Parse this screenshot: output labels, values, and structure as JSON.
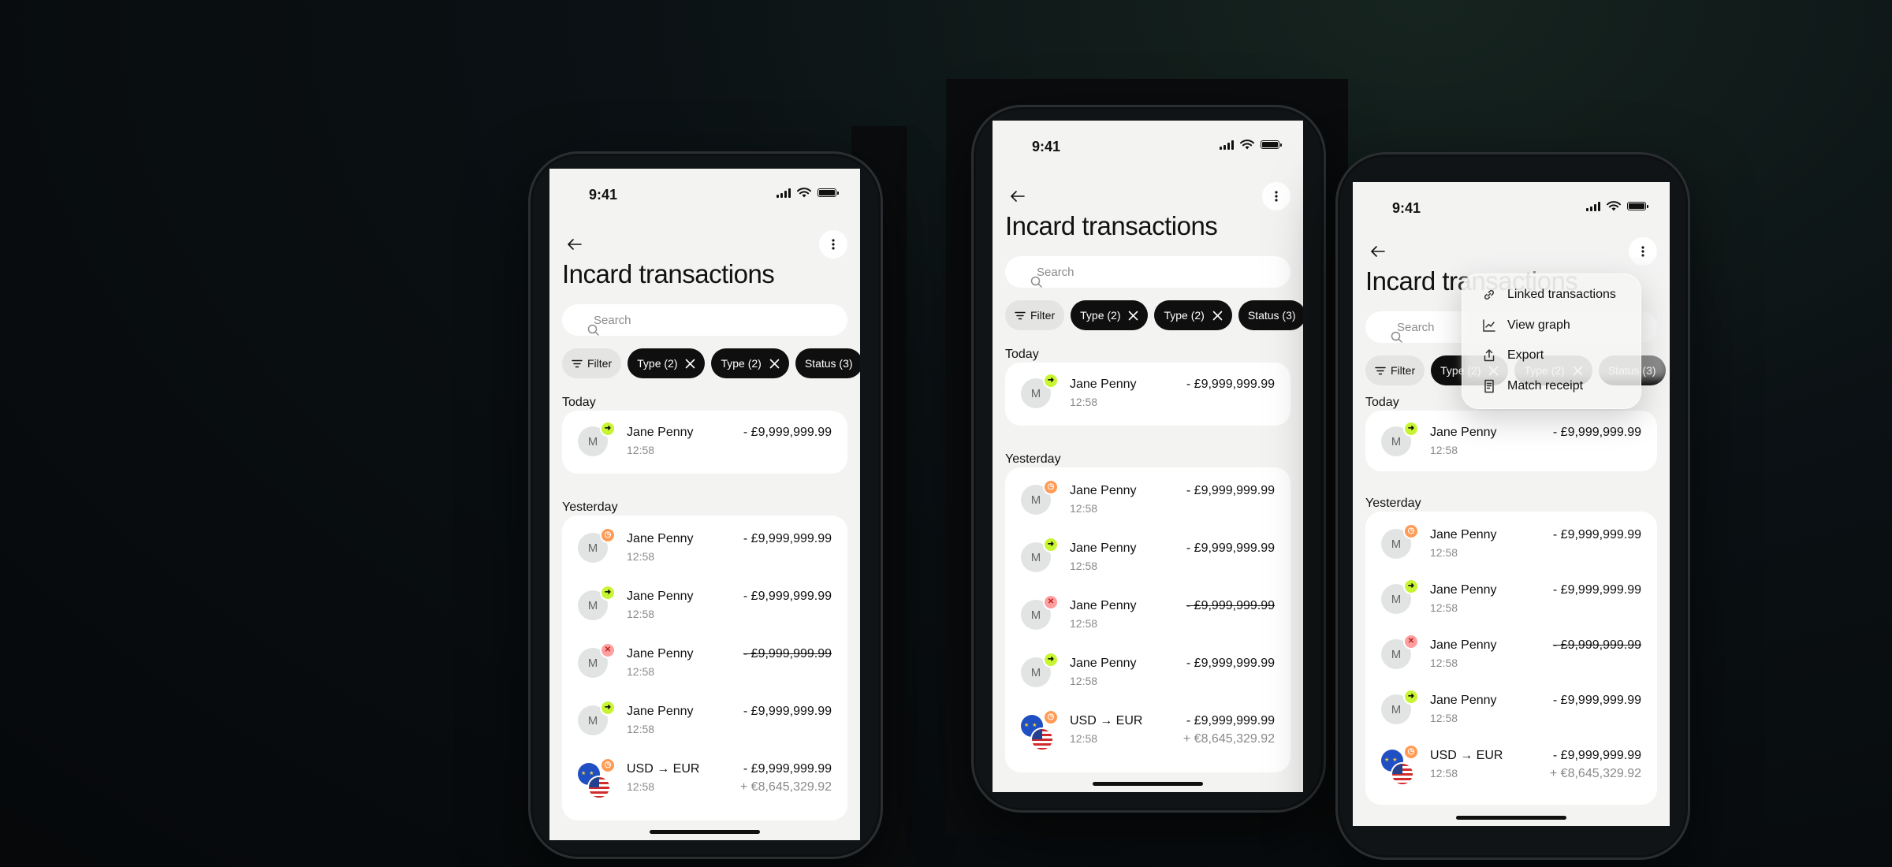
{
  "status_bar": {
    "time": "9:41"
  },
  "header": {
    "title": "Incard transactions"
  },
  "search": {
    "placeholder": "Search"
  },
  "chips": [
    {
      "label": "Filter"
    },
    {
      "label": "Type (2)"
    },
    {
      "label": "Type (2)"
    },
    {
      "label": "Status (3)"
    }
  ],
  "sections": {
    "today": "Today",
    "yesterday": "Yesterday"
  },
  "today_transactions": [
    {
      "avatar": "M",
      "badge": "arrow",
      "name": "Jane Penny",
      "time": "12:58",
      "amount": "- £9,999,999.99"
    }
  ],
  "yesterday_transactions": [
    {
      "avatar": "M",
      "badge": "clock",
      "name": "Jane Penny",
      "time": "12:58",
      "amount": "- £9,999,999.99"
    },
    {
      "avatar": "M",
      "badge": "arrow",
      "name": "Jane Penny",
      "time": "12:58",
      "amount": "- £9,999,999.99"
    },
    {
      "avatar": "M",
      "badge": "cross",
      "name": "Jane Penny",
      "time": "12:58",
      "amount": "- £9,999,999.99",
      "strike": true
    },
    {
      "avatar": "M",
      "badge": "arrow",
      "name": "Jane Penny",
      "time": "12:58",
      "amount": "- £9,999,999.99"
    },
    {
      "avatar": "flags",
      "badge": "clock",
      "name": "USD → EUR",
      "time": "12:58",
      "amount": "- £9,999,999.99",
      "sub_amount": "+ €8,645,329.92"
    }
  ],
  "context_menu": {
    "items": [
      {
        "label": "Linked transactions",
        "icon": "link-icon"
      },
      {
        "label": "View graph",
        "icon": "chart-icon"
      },
      {
        "label": "Export",
        "icon": "share-icon"
      },
      {
        "label": "Match receipt",
        "icon": "receipt-icon"
      }
    ]
  },
  "colors": {
    "badge_green": "#c8f532",
    "badge_orange": "#ff9b55",
    "badge_red": "#ff9e9e",
    "chip_dark": "#0f0f0f",
    "screen_bg": "#f3f3f2"
  }
}
